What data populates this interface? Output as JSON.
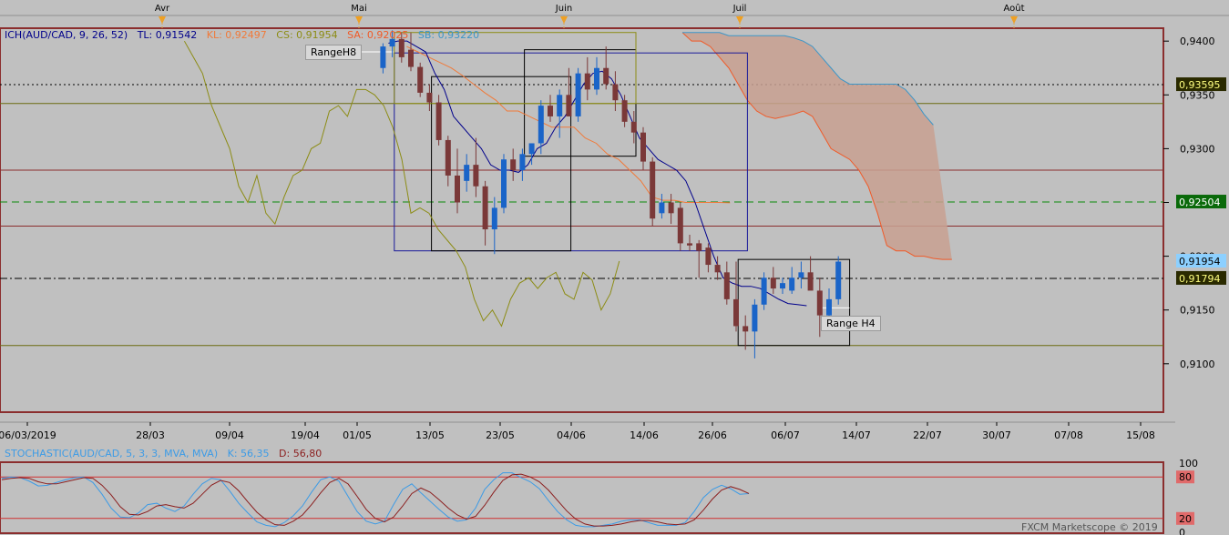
{
  "colors": {
    "background": "#c0c0c0",
    "frame": "#8b2e2e",
    "bull": "#1a64c8",
    "bear": "#7a3838",
    "tenkan": "#00008b",
    "kijun": "#f07a3a",
    "chikou": "#8c8c14",
    "senkou_a": "#f05a28",
    "senkou_b": "#3c96c8",
    "cloud": "#c8a090",
    "stoch_k": "#3c9be6",
    "stoch_d": "#8b1e1e"
  },
  "chart_data": [
    {
      "type": "candlestick",
      "instrument": "AUD/CAD",
      "indicator_label": {
        "ich": "ICH(AUD/CAD, 9, 26, 52)",
        "tl": "TL: 0,91542",
        "kl": "KL: 0,92497",
        "cs": "CS: 0,91954",
        "sa": "SA: 0,92025",
        "sb": "SB: 0,93220"
      },
      "month_markers": [
        "Avr",
        "Mai",
        "Juin",
        "Juil",
        "Août"
      ],
      "x_tick_labels": [
        "06/03/2019",
        "28/03",
        "09/04",
        "19/04",
        "01/05",
        "13/05",
        "23/05",
        "04/06",
        "14/06",
        "26/06",
        "06/07",
        "14/07",
        "22/07",
        "30/07",
        "07/08",
        "15/08"
      ],
      "y_tick_labels": [
        "0,9400",
        "0,9350",
        "0,9300",
        "0,9250",
        "0,9200",
        "0,9150",
        "0,9100"
      ],
      "ylim": [
        0.9055,
        0.9412
      ],
      "price_tags": [
        {
          "label": "0,93595",
          "value": 0.93595,
          "style": "dark"
        },
        {
          "label": "0,92504",
          "value": 0.92504,
          "style": "green"
        },
        {
          "label": "0,91954",
          "value": 0.91954,
          "style": "blue"
        },
        {
          "label": "0,91794",
          "value": 0.91794,
          "style": "dark"
        }
      ],
      "horizontal_levels": [
        {
          "value": 0.93595,
          "style": "dotted-black"
        },
        {
          "value": 0.9342,
          "style": "solid-olive"
        },
        {
          "value": 0.928,
          "style": "solid-brown"
        },
        {
          "value": 0.92504,
          "style": "dashed-green"
        },
        {
          "value": 0.9228,
          "style": "solid-brown"
        },
        {
          "value": 0.91794,
          "style": "dashdot-black"
        },
        {
          "value": 0.9117,
          "style": "solid-olive"
        }
      ],
      "annotations": [
        "RangeH8",
        "Range H4"
      ],
      "range_boxes": [
        {
          "label": "RangeH8",
          "color": "navy",
          "day_from": 14,
          "day_to": 52,
          "top": 0.9389,
          "bottom": 0.9205
        },
        {
          "color": "black",
          "day_from": 18,
          "day_to": 33,
          "top": 0.9367,
          "bottom": 0.9205
        },
        {
          "color": "black",
          "day_from": 28,
          "day_to": 40,
          "top": 0.9392,
          "bottom": 0.9293
        },
        {
          "color": "olive",
          "day_from": 14,
          "day_to": 40,
          "top": 0.9408,
          "bottom": 0.9342
        },
        {
          "label": "Range H4",
          "color": "black",
          "day_from": 51,
          "day_to": 63,
          "top": 0.9197,
          "bottom": 0.9117
        }
      ],
      "candles": [
        {
          "o": 0.9375,
          "h": 0.9398,
          "l": 0.937,
          "c": 0.9395
        },
        {
          "o": 0.9395,
          "h": 0.941,
          "l": 0.9385,
          "c": 0.9402
        },
        {
          "o": 0.9402,
          "h": 0.9408,
          "l": 0.938,
          "c": 0.9385
        },
        {
          "o": 0.9392,
          "h": 0.9408,
          "l": 0.9372,
          "c": 0.9376
        },
        {
          "o": 0.9376,
          "h": 0.938,
          "l": 0.9348,
          "c": 0.9352
        },
        {
          "o": 0.9352,
          "h": 0.936,
          "l": 0.9335,
          "c": 0.9343
        },
        {
          "o": 0.9343,
          "h": 0.935,
          "l": 0.9303,
          "c": 0.9308
        },
        {
          "o": 0.9308,
          "h": 0.9312,
          "l": 0.9265,
          "c": 0.9275
        },
        {
          "o": 0.9275,
          "h": 0.93,
          "l": 0.924,
          "c": 0.925
        },
        {
          "o": 0.927,
          "h": 0.9295,
          "l": 0.926,
          "c": 0.9285
        },
        {
          "o": 0.9285,
          "h": 0.931,
          "l": 0.9255,
          "c": 0.9265
        },
        {
          "o": 0.9265,
          "h": 0.927,
          "l": 0.921,
          "c": 0.9225
        },
        {
          "o": 0.9225,
          "h": 0.9255,
          "l": 0.9202,
          "c": 0.9245
        },
        {
          "o": 0.9245,
          "h": 0.9295,
          "l": 0.924,
          "c": 0.929
        },
        {
          "o": 0.929,
          "h": 0.93,
          "l": 0.927,
          "c": 0.928
        },
        {
          "o": 0.928,
          "h": 0.93,
          "l": 0.927,
          "c": 0.9295
        },
        {
          "o": 0.9295,
          "h": 0.9305,
          "l": 0.9285,
          "c": 0.9305
        },
        {
          "o": 0.9305,
          "h": 0.9345,
          "l": 0.9295,
          "c": 0.934
        },
        {
          "o": 0.934,
          "h": 0.935,
          "l": 0.9325,
          "c": 0.933
        },
        {
          "o": 0.933,
          "h": 0.9355,
          "l": 0.931,
          "c": 0.935
        },
        {
          "o": 0.935,
          "h": 0.9375,
          "l": 0.933,
          "c": 0.933
        },
        {
          "o": 0.933,
          "h": 0.9375,
          "l": 0.9325,
          "c": 0.937
        },
        {
          "o": 0.937,
          "h": 0.9385,
          "l": 0.9345,
          "c": 0.9355
        },
        {
          "o": 0.9355,
          "h": 0.9385,
          "l": 0.935,
          "c": 0.9375
        },
        {
          "o": 0.9375,
          "h": 0.9395,
          "l": 0.9355,
          "c": 0.936
        },
        {
          "o": 0.936,
          "h": 0.9372,
          "l": 0.9335,
          "c": 0.9345
        },
        {
          "o": 0.9345,
          "h": 0.935,
          "l": 0.932,
          "c": 0.9325
        },
        {
          "o": 0.9325,
          "h": 0.9335,
          "l": 0.9305,
          "c": 0.9315
        },
        {
          "o": 0.9315,
          "h": 0.932,
          "l": 0.928,
          "c": 0.9288
        },
        {
          "o": 0.9288,
          "h": 0.9292,
          "l": 0.9228,
          "c": 0.9235
        },
        {
          "o": 0.924,
          "h": 0.9258,
          "l": 0.9235,
          "c": 0.925
        },
        {
          "o": 0.925,
          "h": 0.9258,
          "l": 0.923,
          "c": 0.924
        },
        {
          "o": 0.9245,
          "h": 0.925,
          "l": 0.9205,
          "c": 0.9212
        },
        {
          "o": 0.9212,
          "h": 0.922,
          "l": 0.9205,
          "c": 0.921
        },
        {
          "o": 0.9212,
          "h": 0.9215,
          "l": 0.918,
          "c": 0.9205
        },
        {
          "o": 0.9208,
          "h": 0.9212,
          "l": 0.9185,
          "c": 0.9192
        },
        {
          "o": 0.9192,
          "h": 0.92,
          "l": 0.9178,
          "c": 0.9185
        },
        {
          "o": 0.9185,
          "h": 0.9195,
          "l": 0.9155,
          "c": 0.916
        },
        {
          "o": 0.916,
          "h": 0.9195,
          "l": 0.913,
          "c": 0.9135
        },
        {
          "o": 0.9135,
          "h": 0.9145,
          "l": 0.9113,
          "c": 0.913
        },
        {
          "o": 0.913,
          "h": 0.916,
          "l": 0.9105,
          "c": 0.9155
        },
        {
          "o": 0.9155,
          "h": 0.9185,
          "l": 0.915,
          "c": 0.918
        },
        {
          "o": 0.918,
          "h": 0.919,
          "l": 0.9165,
          "c": 0.917
        },
        {
          "o": 0.917,
          "h": 0.918,
          "l": 0.9165,
          "c": 0.9175
        },
        {
          "o": 0.9168,
          "h": 0.919,
          "l": 0.9165,
          "c": 0.918
        },
        {
          "o": 0.918,
          "h": 0.9195,
          "l": 0.917,
          "c": 0.9185
        },
        {
          "o": 0.9185,
          "h": 0.92,
          "l": 0.9175,
          "c": 0.9168
        },
        {
          "o": 0.9168,
          "h": 0.918,
          "l": 0.9125,
          "c": 0.9145
        },
        {
          "o": 0.9145,
          "h": 0.917,
          "l": 0.9135,
          "c": 0.916
        },
        {
          "o": 0.916,
          "h": 0.92,
          "l": 0.9155,
          "c": 0.9195
        }
      ],
      "tenkan_sen": [
        0.9398,
        0.94,
        0.94,
        0.9395,
        0.939,
        0.937,
        0.9355,
        0.933,
        0.932,
        0.931,
        0.93,
        0.9285,
        0.928,
        0.928,
        0.9278,
        0.9285,
        0.93,
        0.9305,
        0.932,
        0.933,
        0.9345,
        0.936,
        0.937,
        0.9372,
        0.9365,
        0.935,
        0.933,
        0.931,
        0.93,
        0.929,
        0.9285,
        0.928,
        0.927,
        0.925,
        0.9225,
        0.92,
        0.918,
        0.9175,
        0.9172,
        0.9172,
        0.917,
        0.9165,
        0.916,
        0.9156,
        0.9155,
        0.9154
      ],
      "kijun_sen": [
        0.9395,
        0.939,
        0.9385,
        0.938,
        0.9375,
        0.9368,
        0.936,
        0.9352,
        0.9345,
        0.9335,
        0.9335,
        0.933,
        0.9325,
        0.932,
        0.932,
        0.932,
        0.931,
        0.9305,
        0.9295,
        0.929,
        0.928,
        0.927,
        0.9255,
        0.9252,
        0.9252,
        0.925,
        0.925,
        0.925,
        0.925,
        0.92497
      ],
      "chikou_span": [
        0.94,
        0.9385,
        0.937,
        0.934,
        0.932,
        0.93,
        0.9265,
        0.925,
        0.9275,
        0.924,
        0.923,
        0.9255,
        0.9275,
        0.928,
        0.93,
        0.9305,
        0.9335,
        0.934,
        0.933,
        0.9355,
        0.9355,
        0.935,
        0.934,
        0.932,
        0.929,
        0.924,
        0.9245,
        0.924,
        0.9225,
        0.9215,
        0.9205,
        0.919,
        0.916,
        0.914,
        0.915,
        0.9135,
        0.916,
        0.9175,
        0.918,
        0.917,
        0.918,
        0.9185,
        0.9165,
        0.916,
        0.9185,
        0.9178,
        0.915,
        0.9165,
        0.91954
      ],
      "senkou_a": [
        0.9408,
        0.94,
        0.94,
        0.9395,
        0.9385,
        0.9375,
        0.936,
        0.9345,
        0.9335,
        0.933,
        0.9328,
        0.933,
        0.9332,
        0.9335,
        0.933,
        0.9315,
        0.93,
        0.9295,
        0.929,
        0.928,
        0.9265,
        0.924,
        0.921,
        0.9205,
        0.9205,
        0.92,
        0.92,
        0.9198,
        0.9197,
        0.9197
      ],
      "senkou_b": [
        0.9408,
        0.9408,
        0.9408,
        0.9408,
        0.9408,
        0.9405,
        0.9405,
        0.9405,
        0.9405,
        0.9405,
        0.9405,
        0.9405,
        0.9403,
        0.94,
        0.9395,
        0.9385,
        0.9375,
        0.9365,
        0.936,
        0.936,
        0.936,
        0.936,
        0.936,
        0.936,
        0.9355,
        0.9345,
        0.9332,
        0.9322
      ]
    },
    {
      "type": "line",
      "indicator_label": "STOCHASTIC(AUD/CAD, 5, 3, 3, MVA, MVA)",
      "k_label": "K: 56,35",
      "d_label": "D: 56,80",
      "y_tick_labels": [
        "100",
        "80",
        "20",
        "0"
      ],
      "ylim": [
        0,
        100
      ],
      "levels": [
        80,
        20
      ],
      "series": [
        {
          "name": "K",
          "values": [
            78,
            80,
            79,
            74,
            67,
            68,
            72,
            76,
            79,
            80,
            72,
            55,
            35,
            22,
            21,
            28,
            40,
            42,
            35,
            30,
            38,
            55,
            70,
            78,
            76,
            60,
            42,
            28,
            15,
            10,
            8,
            14,
            24,
            38,
            58,
            76,
            80,
            74,
            52,
            30,
            16,
            12,
            16,
            40,
            62,
            70,
            57,
            45,
            33,
            22,
            16,
            18,
            35,
            62,
            76,
            86,
            86,
            79,
            73,
            63,
            46,
            30,
            18,
            10,
            8,
            8,
            10,
            12,
            16,
            18,
            18,
            14,
            10,
            10,
            10,
            14,
            30,
            50,
            62,
            68,
            63,
            55,
            56
          ]
        },
        {
          "name": "D",
          "values": [
            76,
            78,
            79,
            78,
            73,
            70,
            70,
            73,
            76,
            79,
            78,
            68,
            54,
            37,
            26,
            25,
            30,
            38,
            40,
            37,
            35,
            42,
            55,
            68,
            75,
            72,
            60,
            44,
            29,
            18,
            11,
            10,
            16,
            25,
            40,
            57,
            72,
            78,
            70,
            52,
            33,
            20,
            15,
            22,
            38,
            56,
            64,
            58,
            47,
            35,
            25,
            19,
            23,
            39,
            58,
            75,
            83,
            84,
            80,
            73,
            61,
            46,
            31,
            19,
            12,
            9,
            9,
            10,
            12,
            15,
            17,
            17,
            15,
            12,
            11,
            12,
            18,
            32,
            48,
            61,
            66,
            62,
            56
          ]
        }
      ]
    }
  ],
  "footer": {
    "watermark": "FXCM Marketscope © 2019"
  }
}
